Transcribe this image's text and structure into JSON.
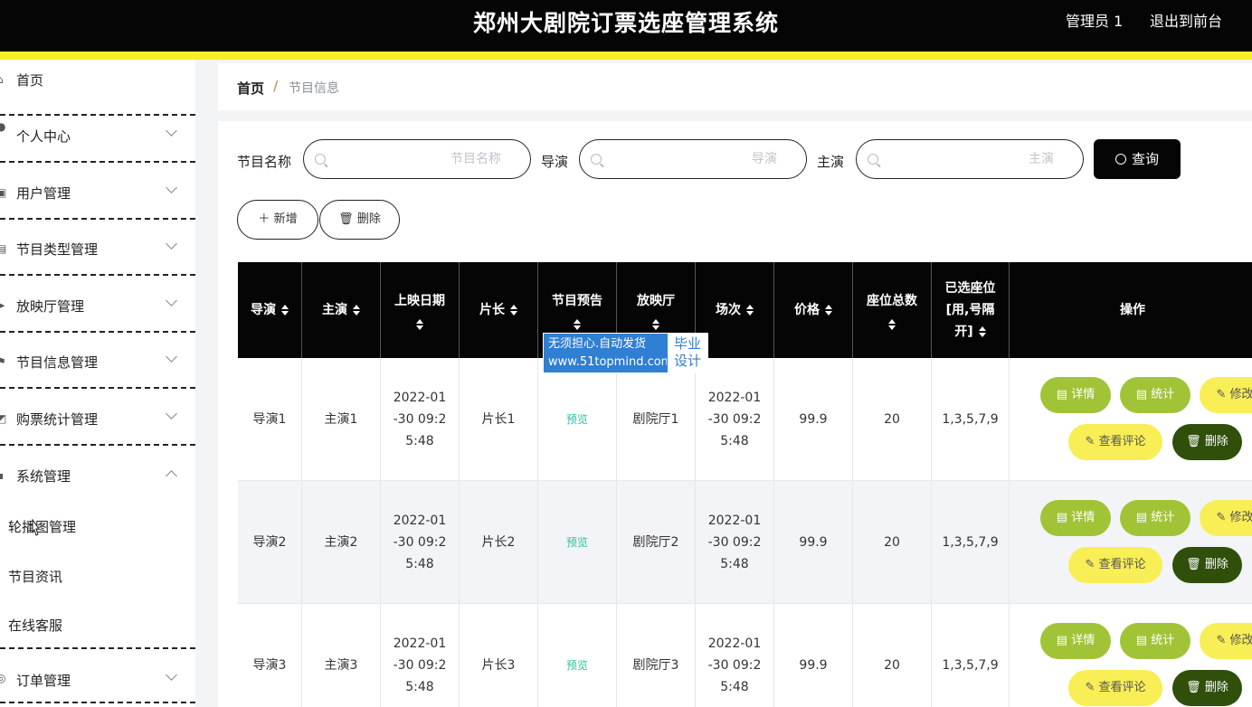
{
  "header": {
    "title": "郑州大剧院订票选座管理系统",
    "admin": "管理员 1",
    "logout": "退出到前台"
  },
  "sidebar": {
    "items": [
      {
        "label": "首页",
        "icon": "home-icon",
        "arrow": ""
      },
      {
        "label": "个人中心",
        "icon": "user-icon",
        "arrow": "down"
      },
      {
        "label": "用户管理",
        "icon": "users-icon",
        "arrow": "down"
      },
      {
        "label": "节目类型管理",
        "icon": "category-icon",
        "arrow": "down"
      },
      {
        "label": "放映厅管理",
        "icon": "send-icon",
        "arrow": "down"
      },
      {
        "label": "节目信息管理",
        "icon": "flag-icon",
        "arrow": "down"
      },
      {
        "label": "购票统计管理",
        "icon": "chart-icon",
        "arrow": "down"
      },
      {
        "label": "系统管理",
        "icon": "grid-icon",
        "arrow": "up"
      }
    ],
    "subitems": [
      "轮播图管理",
      "节目资讯",
      "在线客服"
    ],
    "last_item": {
      "label": "订单管理",
      "icon": "order-icon",
      "arrow": "down"
    }
  },
  "breadcrumb": {
    "home": "首页",
    "separator": "/",
    "current": "节目信息"
  },
  "search": {
    "fields": [
      {
        "label": "节目名称",
        "placeholder": "节目名称"
      },
      {
        "label": "导演",
        "placeholder": "导演"
      },
      {
        "label": "主演",
        "placeholder": "主演"
      }
    ],
    "query_label": "查询"
  },
  "actions": {
    "add_label": "新增",
    "delete_label": "删除"
  },
  "table": {
    "headers": [
      "导演",
      "主演",
      "上映日期",
      "片长",
      "节目预告",
      "放映厅",
      "场次",
      "价格",
      "座位总数",
      "已选座位[用,号隔开]",
      "操作"
    ],
    "header_lines": {
      "showdate": [
        "上映日期"
      ],
      "preview": [
        "节目预告"
      ],
      "hall": [
        "放映厅"
      ],
      "seats_total": [
        "座位总数"
      ],
      "selected": [
        "已选座位",
        "[用,号隔",
        "开]"
      ]
    },
    "rows": [
      {
        "director": "导演1",
        "actor": "主演1",
        "showdate": "2022-01\n-30 09:2\n5:48",
        "duration": "片长1",
        "preview": "预览",
        "hall": "剧院厅1",
        "session": "2022-01\n-30 09:2\n5:48",
        "price": "99.9",
        "seats": "20",
        "selected": "1,3,5,7,9"
      },
      {
        "director": "导演2",
        "actor": "主演2",
        "showdate": "2022-01\n-30 09:2\n5:48",
        "duration": "片长2",
        "preview": "预览",
        "hall": "剧院厅2",
        "session": "2022-01\n-30 09:2\n5:48",
        "price": "99.9",
        "seats": "20",
        "selected": "1,3,5,7,9"
      },
      {
        "director": "导演3",
        "actor": "主演3",
        "showdate": "2022-01\n-30 09:2\n5:48",
        "duration": "片长3",
        "preview": "预览",
        "hall": "剧院厅3",
        "session": "2022-01\n-30 09:2\n5:48",
        "price": "99.9",
        "seats": "20",
        "selected": "1,3,5,7,9"
      }
    ],
    "op_labels": {
      "detail": "详情",
      "stat": "统计",
      "edit": "修改",
      "comment": "查看评论",
      "delete": "删除"
    }
  },
  "watermark": {
    "line1": "无须担心.自动发货",
    "line2": "www.51topmind.com",
    "right1": "毕业",
    "right2": "设计"
  }
}
